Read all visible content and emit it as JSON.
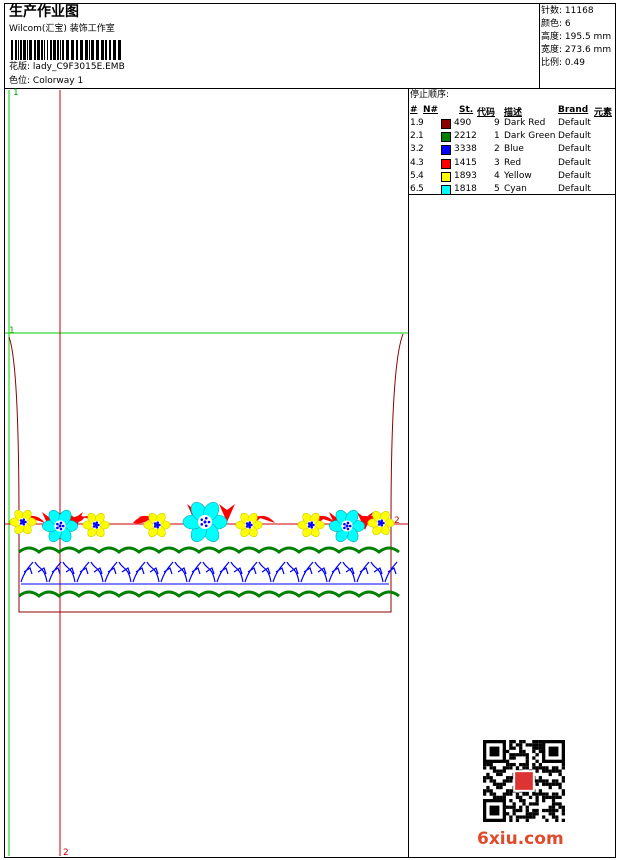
{
  "header": {
    "title": "生产作业图",
    "company": "Wilcom(汇宝) 装饰工作室",
    "design_label": "花版:",
    "design_name": "lady_C9F3015E.EMB",
    "colorway_label": "色位:",
    "colorway_name": "Colorway 1"
  },
  "stats": [
    {
      "label": "针数:",
      "value": "11168"
    },
    {
      "label": "颜色:",
      "value": "6"
    },
    {
      "label": "高度:",
      "value": "195.5 mm"
    },
    {
      "label": "宽度:",
      "value": "273.6 mm"
    },
    {
      "label": "比例:",
      "value": "0.49"
    }
  ],
  "stop_sequence": {
    "title": "停止顺序:",
    "columns": [
      "#",
      "N#",
      "St.",
      "代码",
      "描述",
      "Brand",
      "元素"
    ],
    "rows": [
      {
        "num": "1.",
        "n": "9",
        "st": "490",
        "code": "9",
        "desc": "Dark Red",
        "brand": "Default",
        "color": "#8b0000"
      },
      {
        "num": "2.",
        "n": "1",
        "st": "2212",
        "code": "1",
        "desc": "Dark Green",
        "brand": "Default",
        "color": "#008000"
      },
      {
        "num": "3.",
        "n": "2",
        "st": "3338",
        "code": "2",
        "desc": "Blue",
        "brand": "Default",
        "color": "#0000ff"
      },
      {
        "num": "4.",
        "n": "3",
        "st": "1415",
        "code": "3",
        "desc": "Red",
        "brand": "Default",
        "color": "#ff0000"
      },
      {
        "num": "5.",
        "n": "4",
        "st": "1893",
        "code": "4",
        "desc": "Yellow",
        "brand": "Default",
        "color": "#ffff00"
      },
      {
        "num": "6.",
        "n": "5",
        "st": "1818",
        "code": "5",
        "desc": "Cyan",
        "brand": "Default",
        "color": "#00ffff"
      }
    ]
  },
  "markers": {
    "green_top": "1",
    "green_mid": "1",
    "red_right": "2",
    "red_bottom": "2"
  },
  "watermark": "6xiu.com",
  "palette": {
    "dark_red": "#8b0000",
    "dark_green": "#008000",
    "blue": "#0000ff",
    "red": "#ff0000",
    "yellow": "#ffff00",
    "cyan": "#00ffff",
    "guide_green": "#00cc00",
    "guide_red": "#cc0000"
  },
  "icons": {
    "qr": "qr-code-icon",
    "barcode": "barcode-icon"
  }
}
